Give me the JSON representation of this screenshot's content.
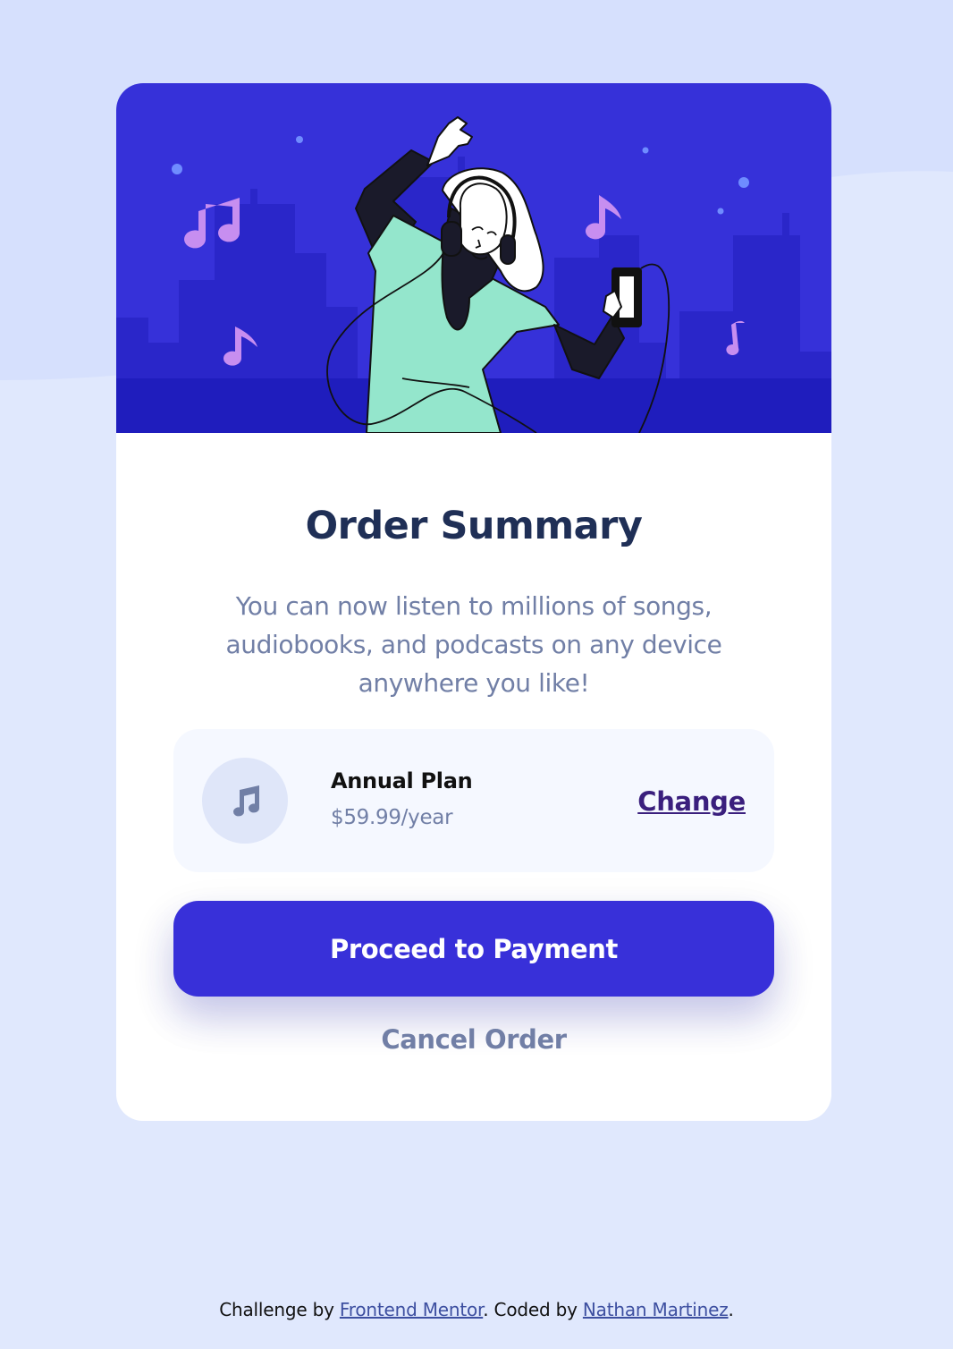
{
  "colors": {
    "page_background": "#e0e8fd",
    "card_background": "#ffffff",
    "hero_background": "#3631d9",
    "title": "#1f2f56",
    "muted_text": "#717fa6",
    "primary_button": "#3830d9",
    "change_link": "#3a1f7d",
    "plan_box": "#f5f8ff"
  },
  "hero": {
    "illustration": "person-dancing-with-headphones-illustration"
  },
  "card": {
    "title": "Order Summary",
    "description": "You can now listen to millions of songs, audiobooks, and podcasts on any device anywhere you like!"
  },
  "plan": {
    "icon": "music-note-icon",
    "name": "Annual Plan",
    "price": "$59.99/year",
    "change_label": "Change"
  },
  "actions": {
    "proceed_label": "Proceed to Payment",
    "cancel_label": "Cancel Order"
  },
  "footer": {
    "prefix": "Challenge by ",
    "challenge_link": "Frontend Mentor",
    "middle": ". Coded by ",
    "author_link": "Nathan Martinez",
    "suffix": "."
  }
}
